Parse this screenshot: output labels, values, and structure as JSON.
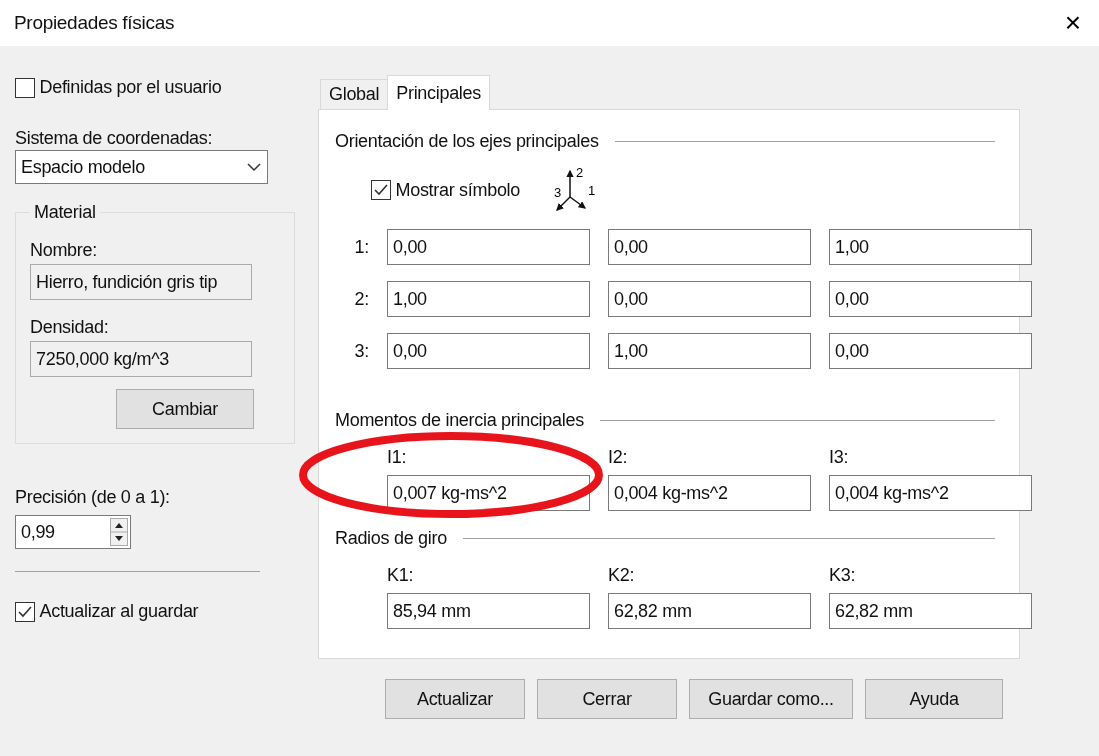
{
  "window": {
    "title": "Propiedades físicas",
    "close": "×"
  },
  "left": {
    "user_defined": {
      "label": "Definidas por el usuario",
      "checked": false
    },
    "coord_label": "Sistema de coordenadas:",
    "coord_value": "Espacio modelo",
    "material": {
      "legend": "Material",
      "name_label": "Nombre:",
      "name_value": "Hierro, fundición gris tip",
      "density_label": "Densidad:",
      "density_value": "7250,000 kg/m^3",
      "change_button": "Cambiar"
    },
    "precision_label": "Precisión (de 0 a 1):",
    "precision_value": "0,99",
    "update_on_save": {
      "label": "Actualizar al guardar",
      "checked": true
    }
  },
  "tabs": [
    {
      "label": "Global",
      "selected": false
    },
    {
      "label": "Principales",
      "selected": true
    }
  ],
  "axes": {
    "heading": "Orientación de los ejes principales",
    "show_symbol": {
      "label": "Mostrar símbolo",
      "checked": true
    },
    "symbol_labels": [
      "2",
      "3",
      "1"
    ],
    "rows": [
      {
        "label": "1:",
        "values": [
          "0,00",
          "0,00",
          "1,00"
        ]
      },
      {
        "label": "2:",
        "values": [
          "1,00",
          "0,00",
          "0,00"
        ]
      },
      {
        "label": "3:",
        "values": [
          "0,00",
          "1,00",
          "0,00"
        ]
      }
    ]
  },
  "moments": {
    "heading": "Momentos de inercia principales",
    "items": [
      {
        "label": "I1:",
        "value": "0,007 kg-ms^2"
      },
      {
        "label": "I2:",
        "value": "0,004 kg-ms^2"
      },
      {
        "label": "I3:",
        "value": "0,004 kg-ms^2"
      }
    ]
  },
  "radii": {
    "heading": "Radios de giro",
    "items": [
      {
        "label": "K1:",
        "value": "85,94 mm"
      },
      {
        "label": "K2:",
        "value": "62,82 mm"
      },
      {
        "label": "K3:",
        "value": "62,82 mm"
      }
    ]
  },
  "buttons": [
    "Actualizar",
    "Cerrar",
    "Guardar como...",
    "Ayuda"
  ],
  "annotations": [
    {
      "kind": "ellipse",
      "color": "#e8141c"
    }
  ]
}
